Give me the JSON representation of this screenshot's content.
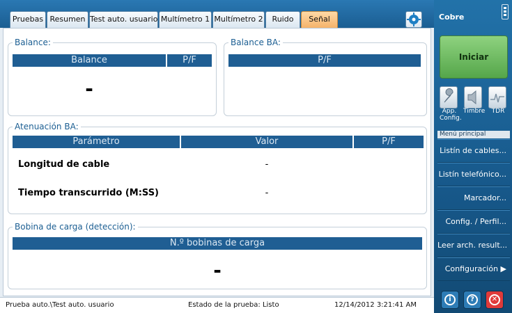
{
  "tabs": [
    {
      "label": "Pruebas",
      "active": false
    },
    {
      "label": "Resumen",
      "active": false
    },
    {
      "label": "Test auto. usuario",
      "active": false
    },
    {
      "label": "Multímetro 1",
      "active": false
    },
    {
      "label": "Multímetro 2",
      "active": false
    },
    {
      "label": "Ruido",
      "active": false
    },
    {
      "label": "Señal",
      "active": true
    }
  ],
  "balance": {
    "title": "Balance:",
    "col_balance": "Balance",
    "col_pf": "P/F",
    "value": "-"
  },
  "balance_ba": {
    "title": "Balance BA:",
    "col_pf": "P/F"
  },
  "atenuacion": {
    "title": "Atenuación BA:",
    "col_param": "Parámetro",
    "col_valor": "Valor",
    "col_pf": "P/F",
    "rows": [
      {
        "label": "Longitud de cable",
        "value": "-"
      },
      {
        "label": "Tiempo transcurrido (M:SS)",
        "value": "-"
      }
    ]
  },
  "bobina": {
    "title": "Bobina de carga (detección):",
    "col_count": "N.º bobinas de carga",
    "value": "-"
  },
  "status": {
    "path": "Prueba auto.\\Test auto. usuario",
    "state": "Estado de la prueba: Listo",
    "datetime": "12/14/2012 3:21:41 AM"
  },
  "side": {
    "title": "Cobre",
    "start": "Iniciar",
    "tools": [
      "App. Config.",
      "Timbre",
      "TDR"
    ],
    "menu_header": "Menú principal",
    "menu": [
      "Listín de cables...",
      "Listín telefónico...",
      "Marcador...",
      "Config. / Perfil...",
      "Leer arch. result...",
      "Configuración ▶"
    ],
    "buttons": {
      "info": "i",
      "help": "?",
      "close": "✕"
    }
  },
  "colors": {
    "accent": "#1f5e93",
    "active_tab": "#f5b36a",
    "start": "#55a64a",
    "close": "#e03a3a"
  }
}
